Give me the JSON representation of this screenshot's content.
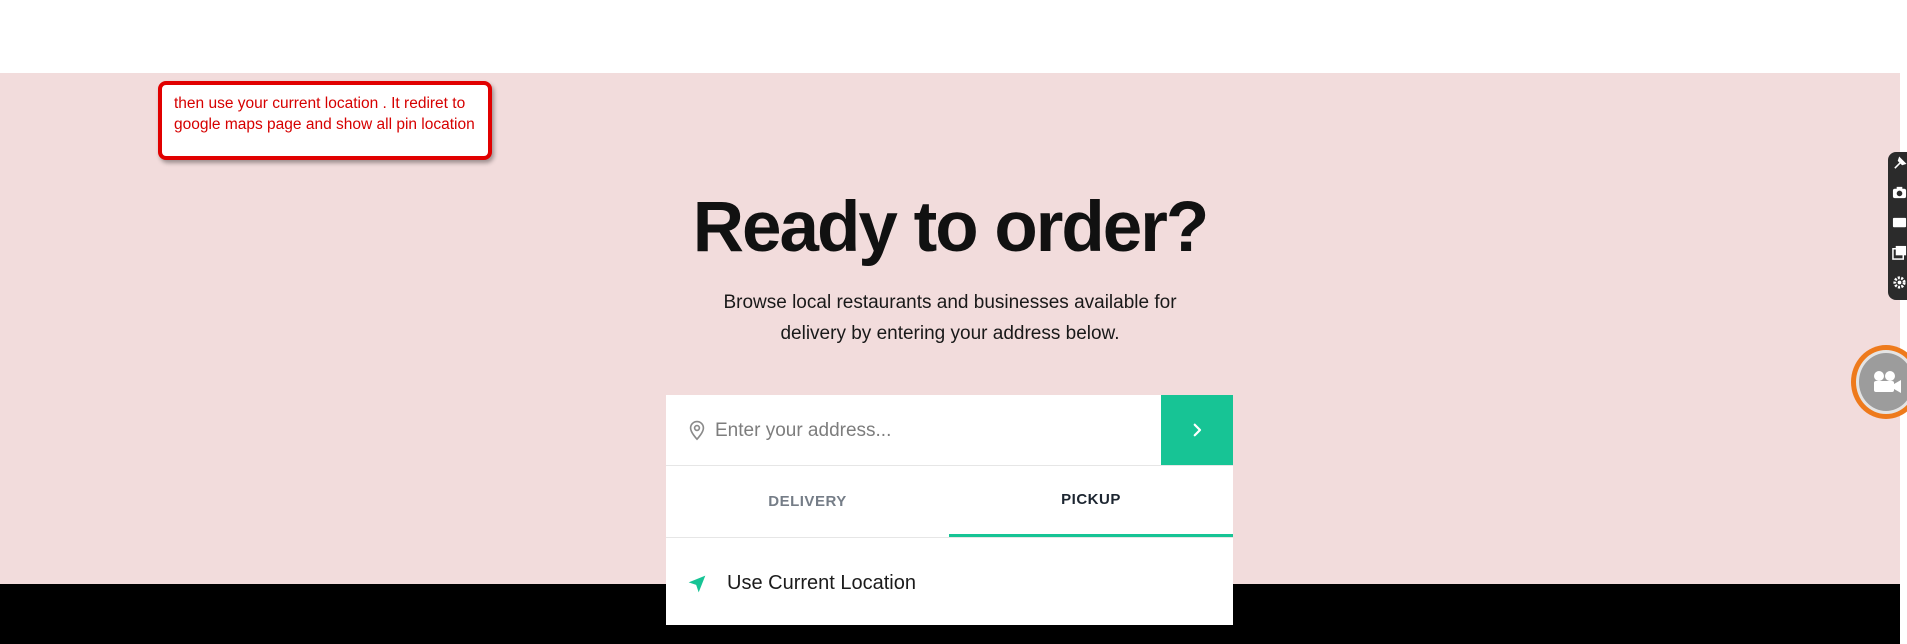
{
  "annotation": {
    "text": "then use your current location . It rediret to google maps page and show all pin location",
    "color": "#e10000"
  },
  "hero": {
    "headline": "Ready to order?",
    "subtext": "Browse local restaurants and businesses available for delivery by entering your address below.",
    "background": "#f2dcdc"
  },
  "search": {
    "placeholder": "Enter your address...",
    "icon": "map-pin-icon",
    "submit_icon": "chevron-right-icon",
    "accent": "#17c495"
  },
  "tabs": {
    "items": [
      {
        "label": "DELIVERY",
        "active": false
      },
      {
        "label": "PICKUP",
        "active": true
      }
    ]
  },
  "location_option": {
    "label": "Use Current Location",
    "icon": "navigation-arrow-icon"
  },
  "side_toolbar": {
    "icons": [
      "pin-icon",
      "camera-icon",
      "rectangle-icon",
      "gallery-icon",
      "gear-icon"
    ]
  },
  "recorder": {
    "icon": "video-camera-icon"
  }
}
